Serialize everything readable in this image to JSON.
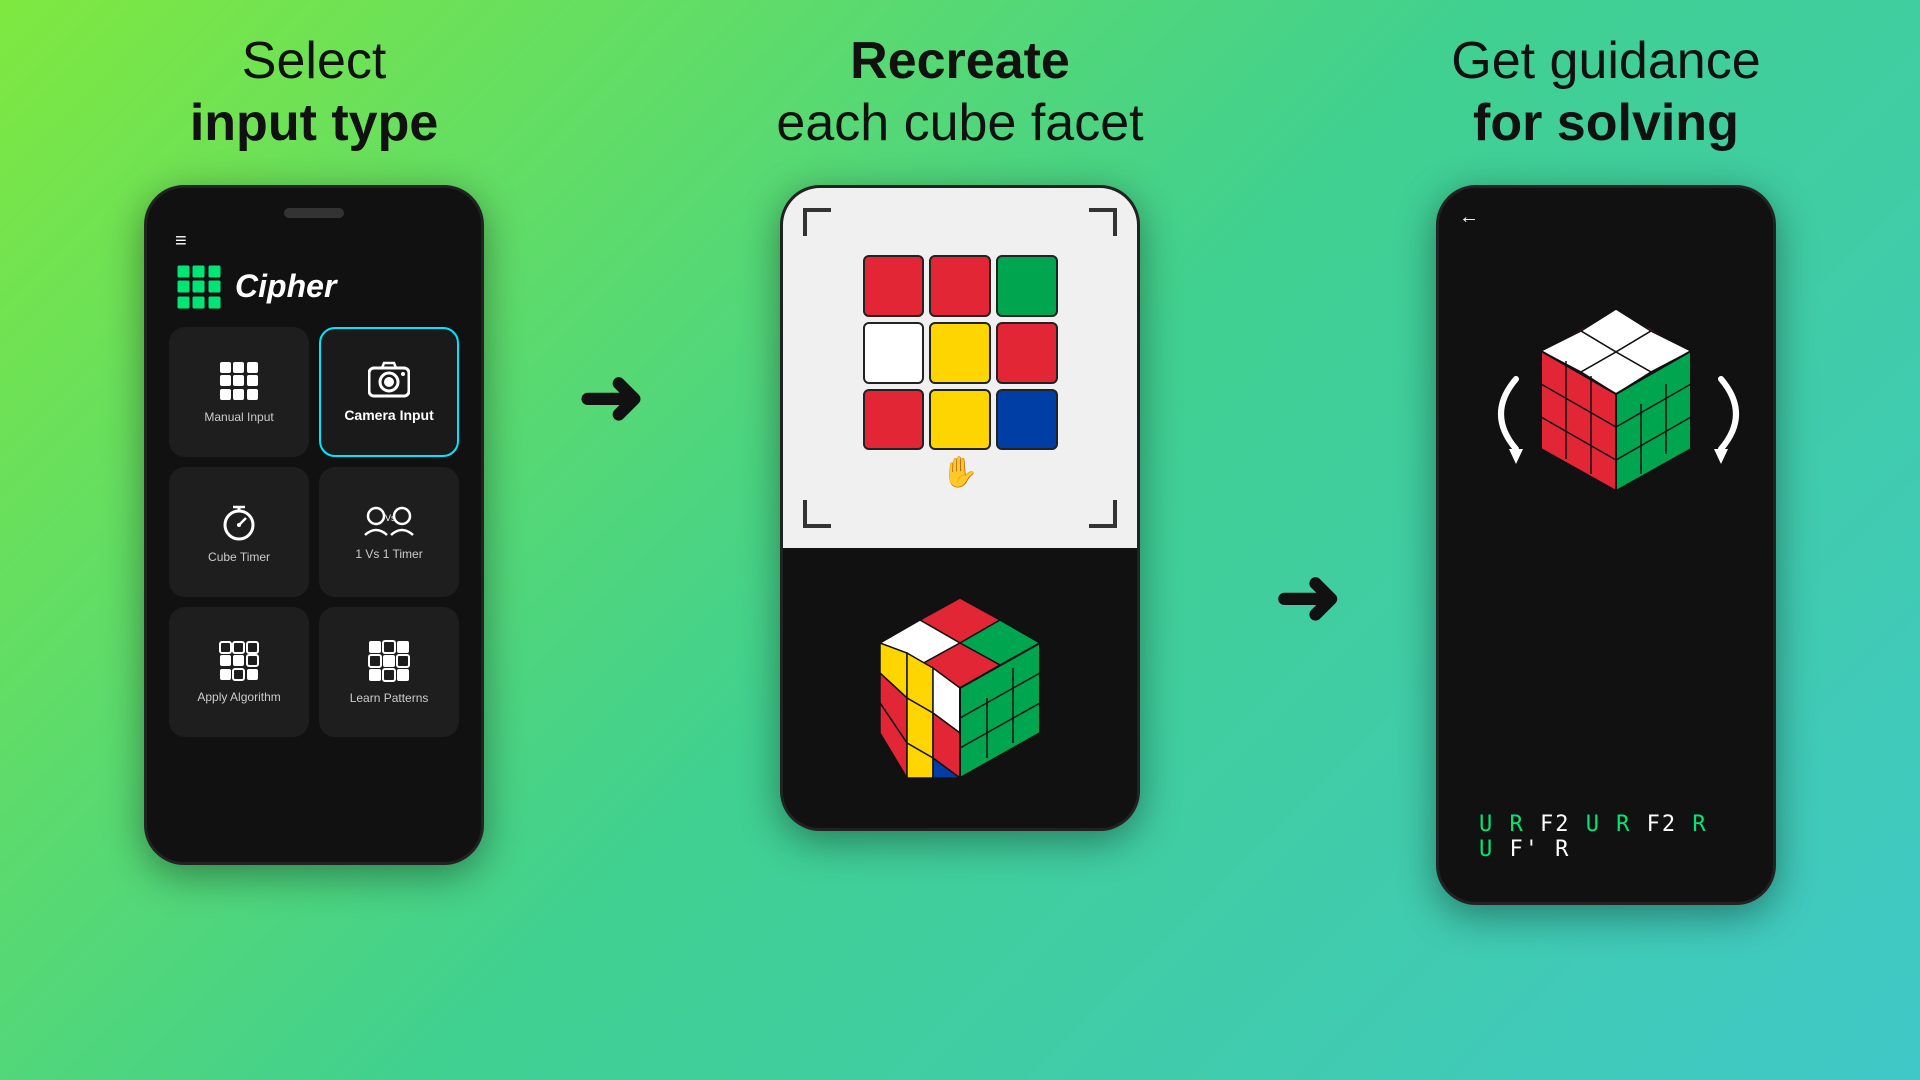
{
  "columns": [
    {
      "id": "col1",
      "title_line1": "Select",
      "title_line2": "input type",
      "title_bold": "input type"
    },
    {
      "id": "col2",
      "title_line1": "Recreate",
      "title_line2": "each cube facet",
      "title_bold": "Recreate"
    },
    {
      "id": "col3",
      "title_line1": "Get guidance",
      "title_line2": "for solving",
      "title_bold": "for solving"
    }
  ],
  "app": {
    "name": "Cipher",
    "hamburger": "≡"
  },
  "menu_items": [
    {
      "id": "manual",
      "label": "Manual Input",
      "icon": "grid"
    },
    {
      "id": "camera",
      "label": "Camera Input",
      "icon": "camera",
      "active": true
    },
    {
      "id": "timer",
      "label": "Cube Timer",
      "icon": "stopwatch"
    },
    {
      "id": "1v1",
      "label": "1 Vs 1\nTimer",
      "icon": "1v1"
    },
    {
      "id": "algorithm",
      "label": "Apply Algorithm",
      "icon": "algo"
    },
    {
      "id": "patterns",
      "label": "Learn Patterns",
      "icon": "pattern"
    }
  ],
  "camera_rubik": {
    "cells": [
      "red",
      "red",
      "green",
      "white",
      "yellow",
      "red",
      "red",
      "yellow",
      "blue"
    ]
  },
  "bottom_rubik": {
    "cells": [
      "red",
      "green",
      "white",
      "white",
      "yellow",
      "red",
      "red",
      "yellow",
      "blue"
    ]
  },
  "algorithm": {
    "text": "U R F2 U R F2 R U F' R",
    "green_parts": [
      "U R ",
      "U R ",
      "R U "
    ],
    "white_parts": [
      "F2 ",
      "F2 ",
      "F' R"
    ]
  },
  "back_label": "←",
  "colors": {
    "background_start": "#7FE840",
    "background_end": "#40C8C8",
    "accent": "#00E5FF",
    "text_dark": "#111111",
    "green_algo": "#00E676"
  }
}
